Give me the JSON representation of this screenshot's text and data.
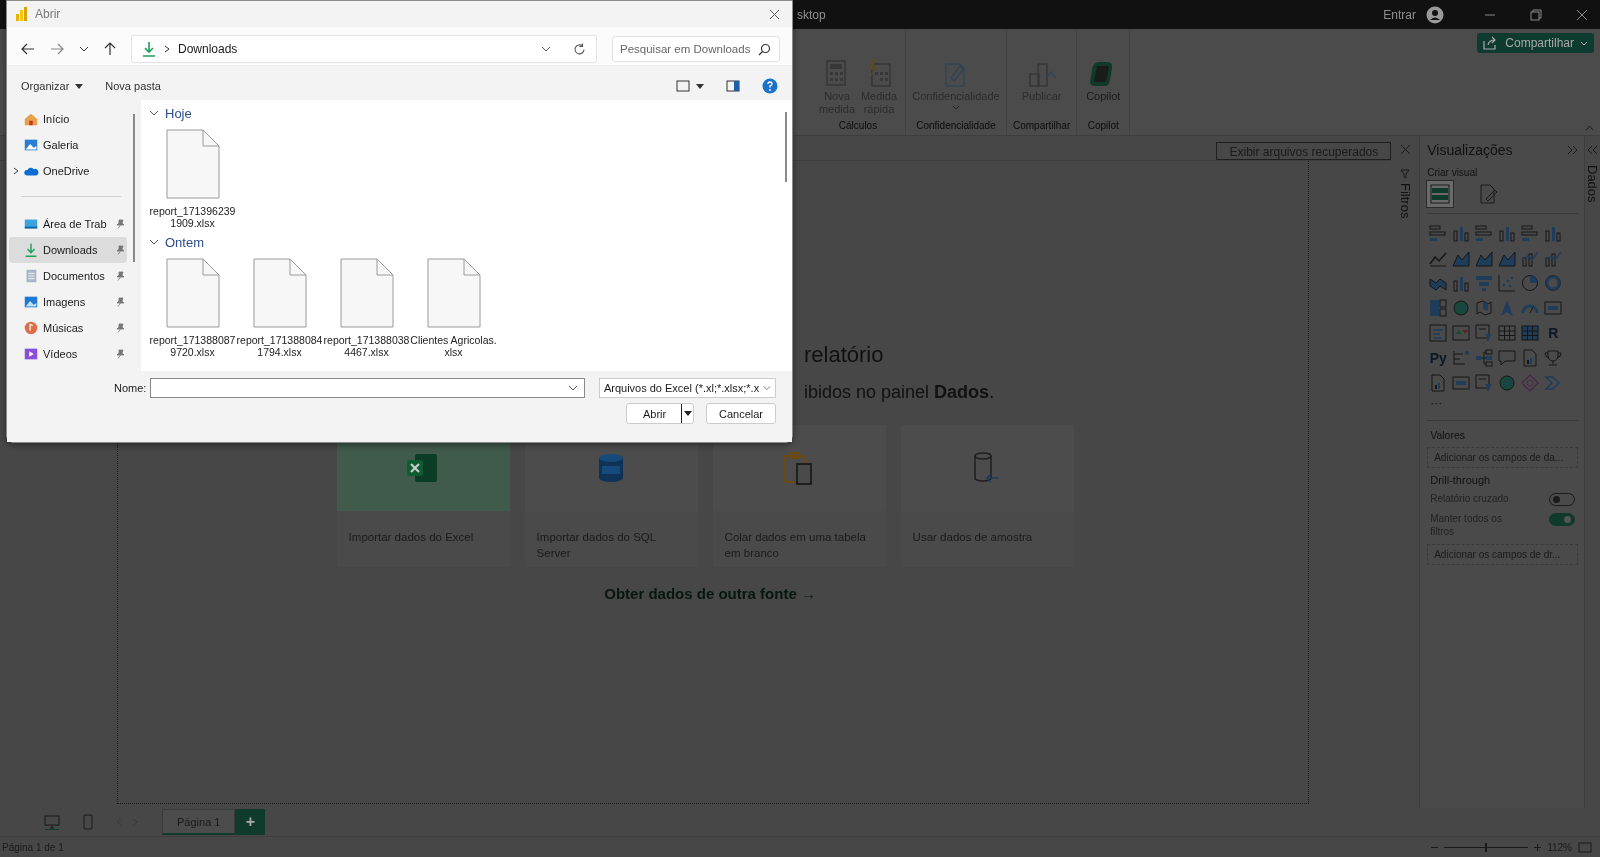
{
  "app": {
    "title_fragment": "sktop",
    "signin": "Entrar",
    "share": "Compartilhar"
  },
  "ribbon_groups": [
    {
      "label": "Cálculos",
      "buttons": [
        {
          "label": "Nova medida",
          "kind": "calc",
          "disabled": true
        },
        {
          "label": "Medida rápida",
          "kind": "quick",
          "disabled": true
        }
      ]
    },
    {
      "label": "Confidencialidade",
      "buttons": [
        {
          "label": "Confidencialidade",
          "kind": "sensitivity",
          "disabled": true,
          "dropdown": true
        }
      ]
    },
    {
      "label": "Compartilhar",
      "buttons": [
        {
          "label": "Publicar",
          "kind": "publish",
          "disabled": true
        }
      ]
    },
    {
      "label": "Copilot",
      "buttons": [
        {
          "label": "Copilot",
          "kind": "copilot",
          "disabled": false
        }
      ]
    }
  ],
  "recovered_button": "Exibir arquivos recuperados",
  "canvas": {
    "heading": "relatório",
    "subtext": "ibidos no painel **Dados**.",
    "link": "Obter dados de outra fonte →",
    "cards": [
      {
        "label": "Importar dados do Excel",
        "kind": "excel",
        "highlighted": true
      },
      {
        "label": "Importar dados do SQL Server",
        "kind": "sql",
        "highlighted": false
      },
      {
        "label": "Colar dados em uma tabela em branco",
        "kind": "paste",
        "highlighted": false
      },
      {
        "label": "Usar dados de amostra",
        "kind": "sample",
        "highlighted": false
      }
    ]
  },
  "filters_tab": "Filtros",
  "data_tab": "Dados",
  "visualizations": {
    "title": "Visualizações",
    "subtitle": "Criar visual",
    "modes": [
      {
        "kind": "build",
        "selected": true
      },
      {
        "kind": "format",
        "selected": false
      }
    ],
    "types": [
      {
        "kind": "hbar"
      },
      {
        "kind": "vbar"
      },
      {
        "kind": "hbar"
      },
      {
        "kind": "vbar"
      },
      {
        "kind": "hbar"
      },
      {
        "kind": "vbar"
      },
      {
        "kind": "line"
      },
      {
        "kind": "area"
      },
      {
        "kind": "area"
      },
      {
        "kind": "area"
      },
      {
        "kind": "combo"
      },
      {
        "kind": "combo"
      },
      {
        "kind": "ribbon"
      },
      {
        "kind": "vbar"
      },
      {
        "kind": "funnel"
      },
      {
        "kind": "scatter"
      },
      {
        "kind": "pie"
      },
      {
        "kind": "donut"
      },
      {
        "kind": "treemap"
      },
      {
        "kind": "globe"
      },
      {
        "kind": "map"
      },
      {
        "kind": "arrow"
      },
      {
        "kind": "gauge"
      },
      {
        "kind": "card"
      },
      {
        "kind": "lines"
      },
      {
        "kind": "kpi"
      },
      {
        "kind": "slicer"
      },
      {
        "kind": "table"
      },
      {
        "kind": "matrix"
      },
      {
        "kind": "text",
        "label": "R"
      },
      {
        "kind": "text",
        "label": "Py"
      },
      {
        "kind": "influencers"
      },
      {
        "kind": "tree"
      },
      {
        "kind": "speech"
      },
      {
        "kind": "doc"
      },
      {
        "kind": "trophy"
      },
      {
        "kind": "doc"
      },
      {
        "kind": "card"
      },
      {
        "kind": "slicer"
      },
      {
        "kind": "globe"
      },
      {
        "kind": "diamond"
      },
      {
        "kind": "chevron"
      }
    ],
    "more": "···",
    "values_label": "Valores",
    "values_placeholder": "Adicionar os campos de da...",
    "drill_label": "Drill-through",
    "toggles": [
      {
        "label": "Relatório cruzado",
        "on": false
      },
      {
        "label": "Manter todos os filtros",
        "on": true
      }
    ],
    "drill_placeholder": "Adicionar os campos de dr..."
  },
  "pages": {
    "tabs": [
      {
        "label": "Página 1",
        "selected": true
      }
    ],
    "add": "+"
  },
  "status": {
    "page": "Página 1 de 1",
    "zoom": "112%",
    "zoom_slider": {
      "level": 0.5
    }
  },
  "dialog": {
    "title": "Abrir",
    "path": "Downloads",
    "search_placeholder": "Pesquisar em Downloads",
    "organize": "Organizar",
    "new_folder": "Nova pasta",
    "nav": [
      {
        "label": "Início",
        "kind": "home",
        "selected": false,
        "pinned": false,
        "expandable": false
      },
      {
        "label": "Galeria",
        "kind": "gallery",
        "selected": false,
        "pinned": false,
        "expandable": false
      },
      {
        "label": "OneDrive",
        "kind": "cloud",
        "selected": false,
        "pinned": false,
        "expandable": true
      },
      {
        "label": "Área de Trab",
        "kind": "desktop",
        "selected": false,
        "pinned": true,
        "expandable": false
      },
      {
        "label": "Downloads",
        "kind": "download",
        "selected": true,
        "pinned": true,
        "expandable": false
      },
      {
        "label": "Documentos",
        "kind": "documents",
        "selected": false,
        "pinned": true,
        "expandable": false
      },
      {
        "label": "Imagens",
        "kind": "pictures",
        "selected": false,
        "pinned": true,
        "expandable": false
      },
      {
        "label": "Músicas",
        "kind": "music",
        "selected": false,
        "pinned": true,
        "expandable": false
      },
      {
        "label": "Vídeos",
        "kind": "videos",
        "selected": false,
        "pinned": true,
        "expandable": false
      }
    ],
    "groups": [
      {
        "label": "Hoje",
        "expanded": true,
        "files": [
          "report_1713962391909.xlsx"
        ]
      },
      {
        "label": "Ontem",
        "expanded": true,
        "files": [
          "report_1713880879720.xlsx",
          "report_1713880841794.xlsx",
          "report_1713880384467.xlsx",
          "Clientes Agricolas.xlsx"
        ]
      }
    ],
    "name_label": "Nome:",
    "filter": "Arquivos do Excel (*.xl;*.xlsx;*.x",
    "open": "Abrir",
    "cancel": "Cancelar"
  }
}
